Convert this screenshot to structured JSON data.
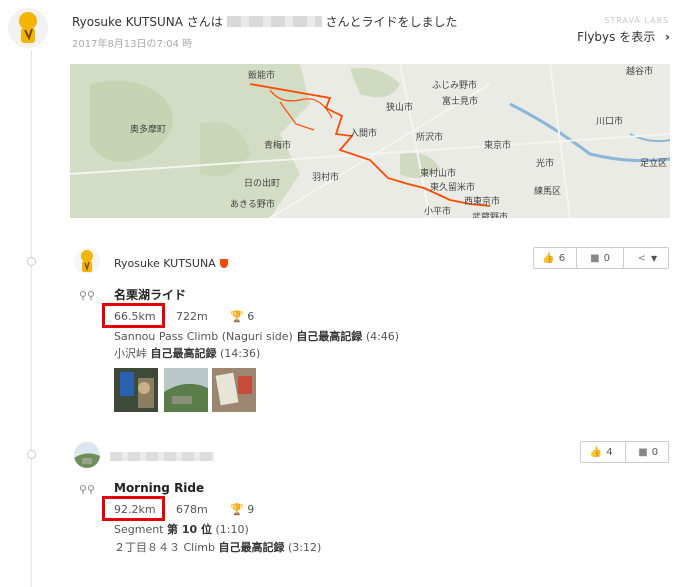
{
  "header": {
    "user": "Ryosuke KUTSUNA",
    "text_before": "さんは",
    "text_after": "さんとライドをしました",
    "date": "2017年8月13日の7:04 時",
    "labs": "STRAVA LABS",
    "flybys": "Flybys を表示",
    "flybys_icon": "chevron-right-icon"
  },
  "map": {
    "labels": [
      "飯能市",
      "ふじみ野市",
      "富士見市",
      "狭山市",
      "奥多摩町",
      "入間市",
      "所沢市",
      "東京市",
      "川口市",
      "青梅市",
      "羽村市",
      "東村山市",
      "光市",
      "足立区",
      "東久留米市",
      "練馬区",
      "日の出町",
      "あきる野市",
      "西東京市",
      "小平市",
      "武蔵野市",
      "越谷市"
    ],
    "route_color": "#fc4c02"
  },
  "activities": [
    {
      "athlete": "Ryosuke KUTSUNA",
      "title": "名栗湖ライド",
      "distance": "66.5km",
      "elevation": "722m",
      "achievements": "6",
      "segments": [
        {
          "name": "Sannou Pass Climb (Naguri side)",
          "award": "自己最高記録",
          "time": "(4:46)"
        },
        {
          "name": "小沢峠",
          "award": "自己最高記録",
          "time": "(14:36)"
        }
      ],
      "kudos": "6",
      "comments": "0"
    },
    {
      "athlete": "",
      "title": "Morning Ride",
      "distance": "92.2km",
      "elevation": "678m",
      "achievements": "9",
      "segments": [
        {
          "name": "Segment",
          "award": "第 10 位",
          "time": "(1:10)"
        },
        {
          "name": "２丁目８４３ Climb",
          "award": "自己最高記録",
          "time": "(3:12)"
        }
      ],
      "kudos": "4",
      "comments": "0"
    }
  ],
  "icons": {
    "kudos": "thumbs-up-icon",
    "comment": "comment-icon",
    "share": "share-icon",
    "bike": "bike-icon",
    "trophy": "trophy-icon"
  },
  "colors": {
    "accent": "#fc4c02",
    "highlight_box": "#e60000"
  }
}
